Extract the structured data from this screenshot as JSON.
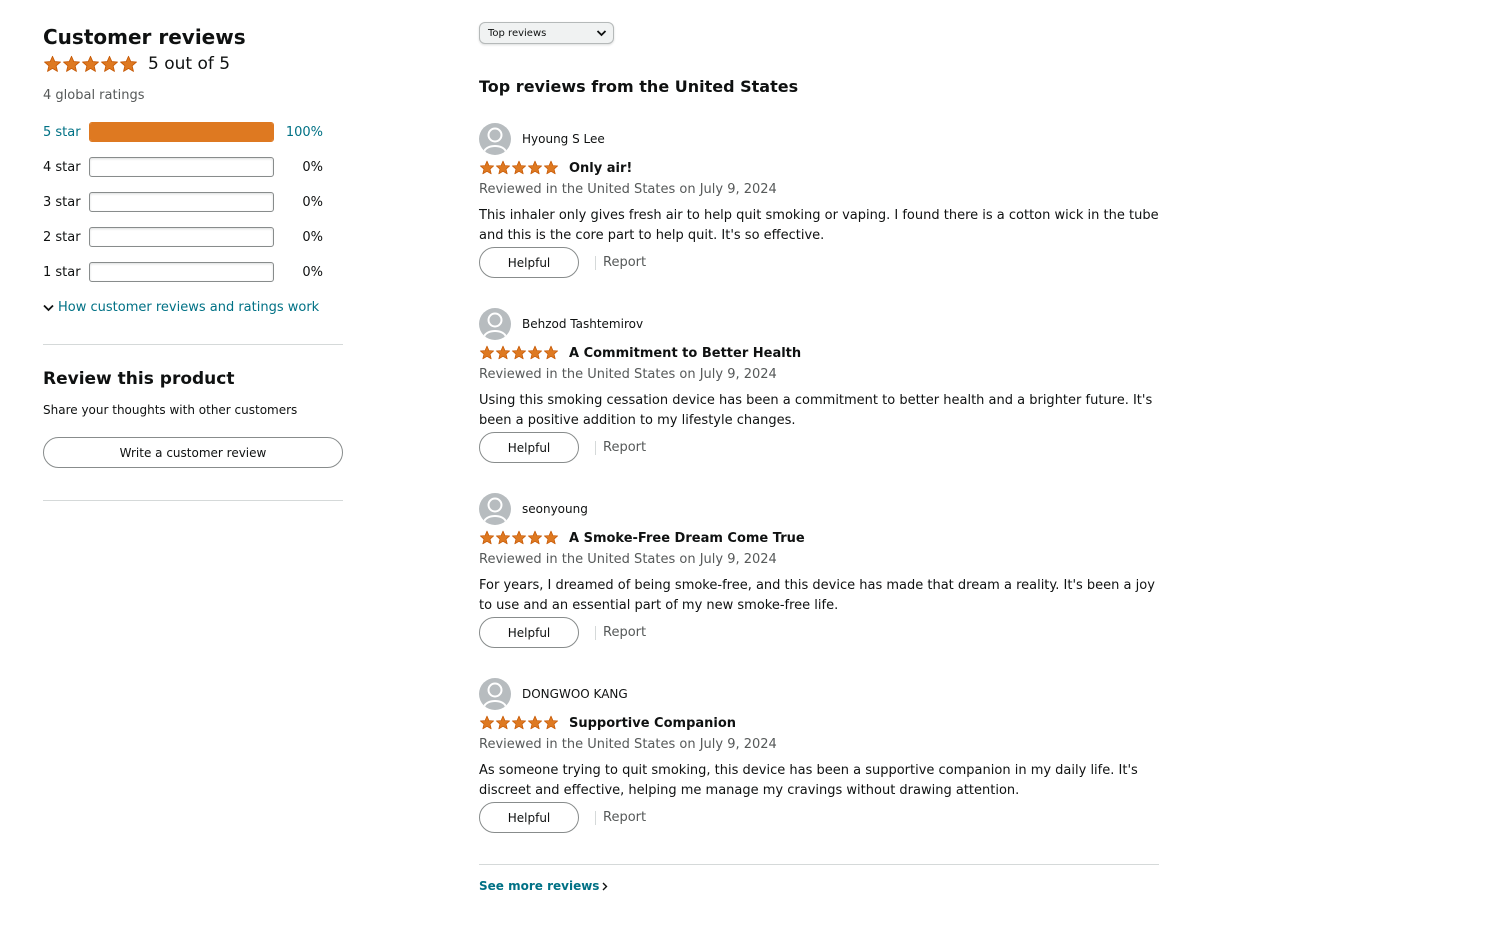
{
  "summary": {
    "title": "Customer reviews",
    "rating_value": 5,
    "rating_text": "5 out of 5",
    "global_ratings": "4 global ratings",
    "histogram": [
      {
        "label": "5 star",
        "percent": 100,
        "percent_text": "100%",
        "active": true
      },
      {
        "label": "4 star",
        "percent": 0,
        "percent_text": "0%",
        "active": false
      },
      {
        "label": "3 star",
        "percent": 0,
        "percent_text": "0%",
        "active": false
      },
      {
        "label": "2 star",
        "percent": 0,
        "percent_text": "0%",
        "active": false
      },
      {
        "label": "1 star",
        "percent": 0,
        "percent_text": "0%",
        "active": false
      }
    ],
    "how_link": "How customer reviews and ratings work"
  },
  "review_product": {
    "title": "Review this product",
    "subtitle": "Share your thoughts with other customers",
    "button": "Write a customer review"
  },
  "sort": {
    "selected": "Top reviews"
  },
  "reviews_heading": "Top reviews from the United States",
  "reviews": [
    {
      "author": "Hyoung S Lee",
      "rating": 5,
      "title": "Only air!",
      "date": "Reviewed in the United States on July 9, 2024",
      "body": "This inhaler only gives fresh air to help quit smoking or vaping. I found there is a cotton wick in the tube and this is the core part to help quit. It's so effective.",
      "helpful": "Helpful",
      "report": "Report"
    },
    {
      "author": "Behzod Tashtemirov",
      "rating": 5,
      "title": "A Commitment to Better Health",
      "date": "Reviewed in the United States on July 9, 2024",
      "body": "Using this smoking cessation device has been a commitment to better health and a brighter future. It's been a positive addition to my lifestyle changes.",
      "helpful": "Helpful",
      "report": "Report"
    },
    {
      "author": "seonyoung",
      "rating": 5,
      "title": "A Smoke-Free Dream Come True",
      "date": "Reviewed in the United States on July 9, 2024",
      "body": "For years, I dreamed of being smoke-free, and this device has made that dream a reality. It's been a joy to use and an essential part of my new smoke-free life.",
      "helpful": "Helpful",
      "report": "Report"
    },
    {
      "author": "DONGWOO KANG",
      "rating": 5,
      "title": "Supportive Companion",
      "date": "Reviewed in the United States on July 9, 2024",
      "body": "As someone trying to quit smoking, this device has been a supportive companion in my daily life. It's discreet and effective, helping me manage my cravings without drawing attention.",
      "helpful": "Helpful",
      "report": "Report"
    }
  ],
  "see_more": "See more reviews",
  "colors": {
    "star": "#de7921",
    "link": "#007185",
    "bar_fill": "#de7921"
  },
  "icons": {
    "star": "star-icon",
    "avatar": "user-avatar-icon",
    "chevron_down": "chevron-down-icon",
    "chevron_right": "chevron-right-icon"
  }
}
